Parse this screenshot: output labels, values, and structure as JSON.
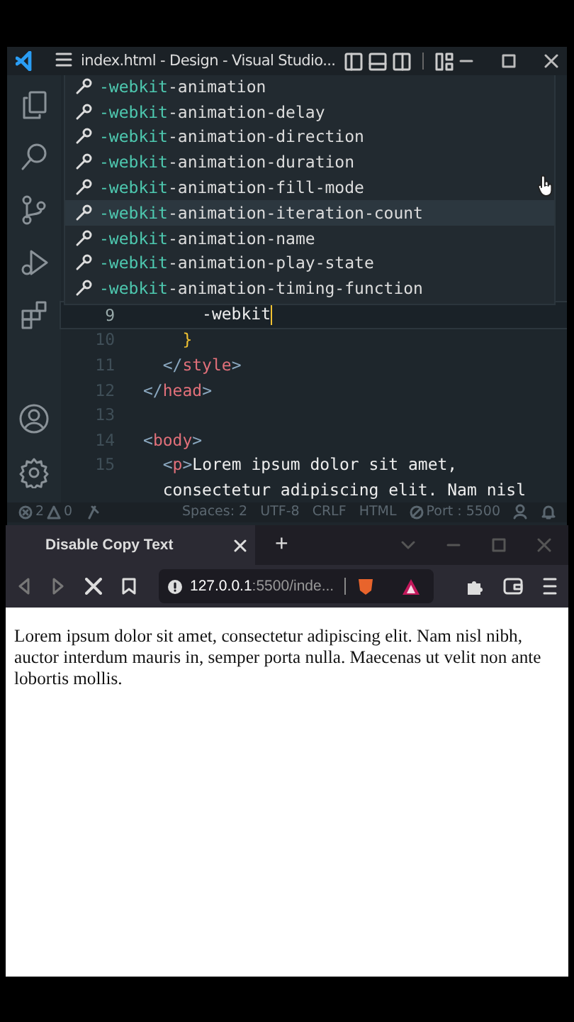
{
  "editor_window": {
    "title": "index.html - Design - Visual Studio...",
    "suggestions": [
      {
        "label": "-webkit-animation",
        "selected": false
      },
      {
        "label": "-webkit-animation-delay",
        "selected": false
      },
      {
        "label": "-webkit-animation-direction",
        "selected": false
      },
      {
        "label": "-webkit-animation-duration",
        "selected": false
      },
      {
        "label": "-webkit-animation-fill-mode",
        "selected": false
      },
      {
        "label": "-webkit-animation-iteration-count",
        "selected": true
      },
      {
        "label": "-webkit-animation-name",
        "selected": false
      },
      {
        "label": "-webkit-animation-play-state",
        "selected": false
      },
      {
        "label": "-webkit-animation-timing-function",
        "selected": false
      }
    ],
    "lines": [
      {
        "number": "9",
        "current": true,
        "tokens": [
          {
            "kind": "text",
            "text": "      -webkit"
          }
        ]
      },
      {
        "number": "10",
        "current": false,
        "tokens": [
          {
            "kind": "bracket",
            "text": "    }"
          }
        ]
      },
      {
        "number": "11",
        "current": false,
        "tokens": [
          {
            "kind": "punct",
            "text": "  </"
          },
          {
            "kind": "tag",
            "text": "style"
          },
          {
            "kind": "punct",
            "text": ">"
          }
        ]
      },
      {
        "number": "12",
        "current": false,
        "tokens": [
          {
            "kind": "punct",
            "text": "</"
          },
          {
            "kind": "tag",
            "text": "head"
          },
          {
            "kind": "punct",
            "text": ">"
          }
        ]
      },
      {
        "number": "13",
        "current": false
      },
      {
        "number": "14",
        "current": false,
        "tokens": [
          {
            "kind": "punct",
            "text": "<"
          },
          {
            "kind": "tag",
            "text": "body"
          },
          {
            "kind": "punct",
            "text": ">"
          }
        ]
      },
      {
        "number": "15",
        "current": false,
        "tokens": [
          {
            "kind": "punct",
            "text": "  <"
          },
          {
            "kind": "tag",
            "text": "p"
          },
          {
            "kind": "punct",
            "text": ">"
          },
          {
            "kind": "text",
            "text": "Lorem ipsum dolor sit amet,"
          }
        ]
      },
      {
        "current": false,
        "tokens": [
          {
            "kind": "text",
            "text": "  consectetur adipiscing elit. Nam nisl"
          }
        ]
      }
    ],
    "status_bar": {
      "errors": "2",
      "warnings": "0",
      "spaces": "Spaces: 2",
      "encoding": "UTF-8",
      "line_ending": "CRLF",
      "language": "HTML",
      "port": "Port : 5500"
    }
  },
  "browser_window": {
    "tab": {
      "title": "Disable Copy Text"
    },
    "new_tab": "+",
    "address": {
      "host": "127.0.0.1",
      "rest": ":5500/inde..."
    },
    "content": "Lorem ipsum dolor sit amet, consectetur adipiscing elit. Nam nisl nibh, auctor interdum mauris in, semper porta nulla. Maecenas ut velit non ante lobortis mollis."
  }
}
